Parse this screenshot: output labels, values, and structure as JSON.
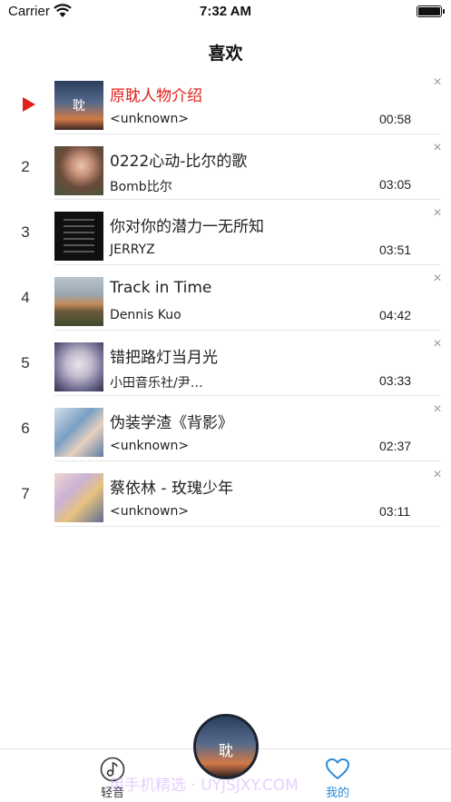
{
  "status_bar": {
    "carrier": "Carrier",
    "time": "7:32 AM"
  },
  "nav": {
    "title": "喜欢"
  },
  "songs": [
    {
      "index": "",
      "playing": true,
      "title": "原耽人物介绍",
      "artist": "<unknown>",
      "duration": "00:58",
      "cover_icon": "album-cover-sunset",
      "cover_glyph": "耽"
    },
    {
      "index": "2",
      "playing": false,
      "title": "0222心动-比尔的歌",
      "artist": "Bomb比尔",
      "duration": "03:05",
      "cover_icon": "album-cover-portrait"
    },
    {
      "index": "3",
      "playing": false,
      "title": "你对你的潜力一无所知",
      "artist": "JERRYZ",
      "duration": "03:51",
      "cover_icon": "album-cover-text"
    },
    {
      "index": "4",
      "playing": false,
      "title": "Track in Time",
      "artist": "Dennis Kuo",
      "duration": "04:42",
      "cover_icon": "album-cover-landscape"
    },
    {
      "index": "5",
      "playing": false,
      "title": "错把路灯当月光",
      "artist": "小田音乐社/尹…",
      "duration": "03:33",
      "cover_icon": "album-cover-anime"
    },
    {
      "index": "6",
      "playing": false,
      "title": "伪装学渣《背影》",
      "artist": "<unknown>",
      "duration": "02:37",
      "cover_icon": "album-cover-illustration"
    },
    {
      "index": "7",
      "playing": false,
      "title": "蔡依林 - 玫瑰少年",
      "artist": "<unknown>",
      "duration": "03:11",
      "cover_icon": "album-cover-illustration-2"
    }
  ],
  "tabs": [
    {
      "label": "轻音",
      "icon": "music-note-icon",
      "active": false
    },
    {
      "label": "我的",
      "icon": "heart-icon",
      "active": true
    }
  ],
  "player": {
    "cover_glyph": "耽"
  },
  "watermark": "用手机精选 · UYJSJXY.COM",
  "colors": {
    "accent_red": "#e0201b",
    "tab_active_blue": "#2b8ad8"
  }
}
